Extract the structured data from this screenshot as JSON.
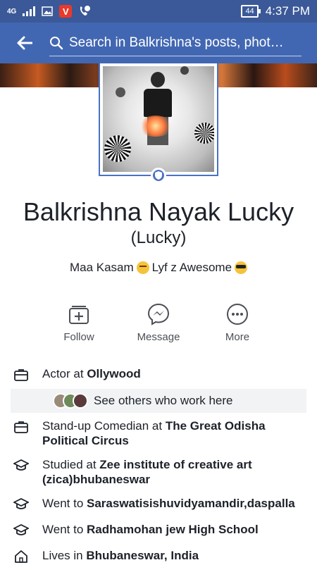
{
  "status_bar": {
    "network": "4G",
    "battery": "44",
    "time": "4:37 PM"
  },
  "nav": {
    "search_placeholder": "Search in Balkrishna's posts, phot…"
  },
  "profile": {
    "name": "Balkrishna Nayak Lucky",
    "nickname": "(Lucky)",
    "bio_part1": "Maa Kasam",
    "bio_part2": "Lyf z Awesome"
  },
  "actions": [
    {
      "label": "Follow",
      "icon": "follow-icon"
    },
    {
      "label": "Message",
      "icon": "messenger-icon"
    },
    {
      "label": "More",
      "icon": "more-icon"
    }
  ],
  "about": {
    "work1_prefix": "Actor at ",
    "work1_place": "Ollywood",
    "see_others": "See others who work here",
    "work2_prefix": "Stand-up Comedian at ",
    "work2_place": "The Great Odisha Political Circus",
    "edu1_prefix": "Studied at ",
    "edu1_place": "Zee institute of creative art (zica)bhubaneswar",
    "edu2_prefix": "Went to ",
    "edu2_place": "Saraswatisishuvidyamandir,daspalla",
    "edu3_prefix": "Went to ",
    "edu3_place": "Radhamohan jew High School",
    "home_prefix": "Lives in ",
    "home_place": "Bhubaneswar, India"
  },
  "colors": {
    "brand": "#3b5998",
    "nav": "#4267b2",
    "accent": "#4a72c4"
  }
}
